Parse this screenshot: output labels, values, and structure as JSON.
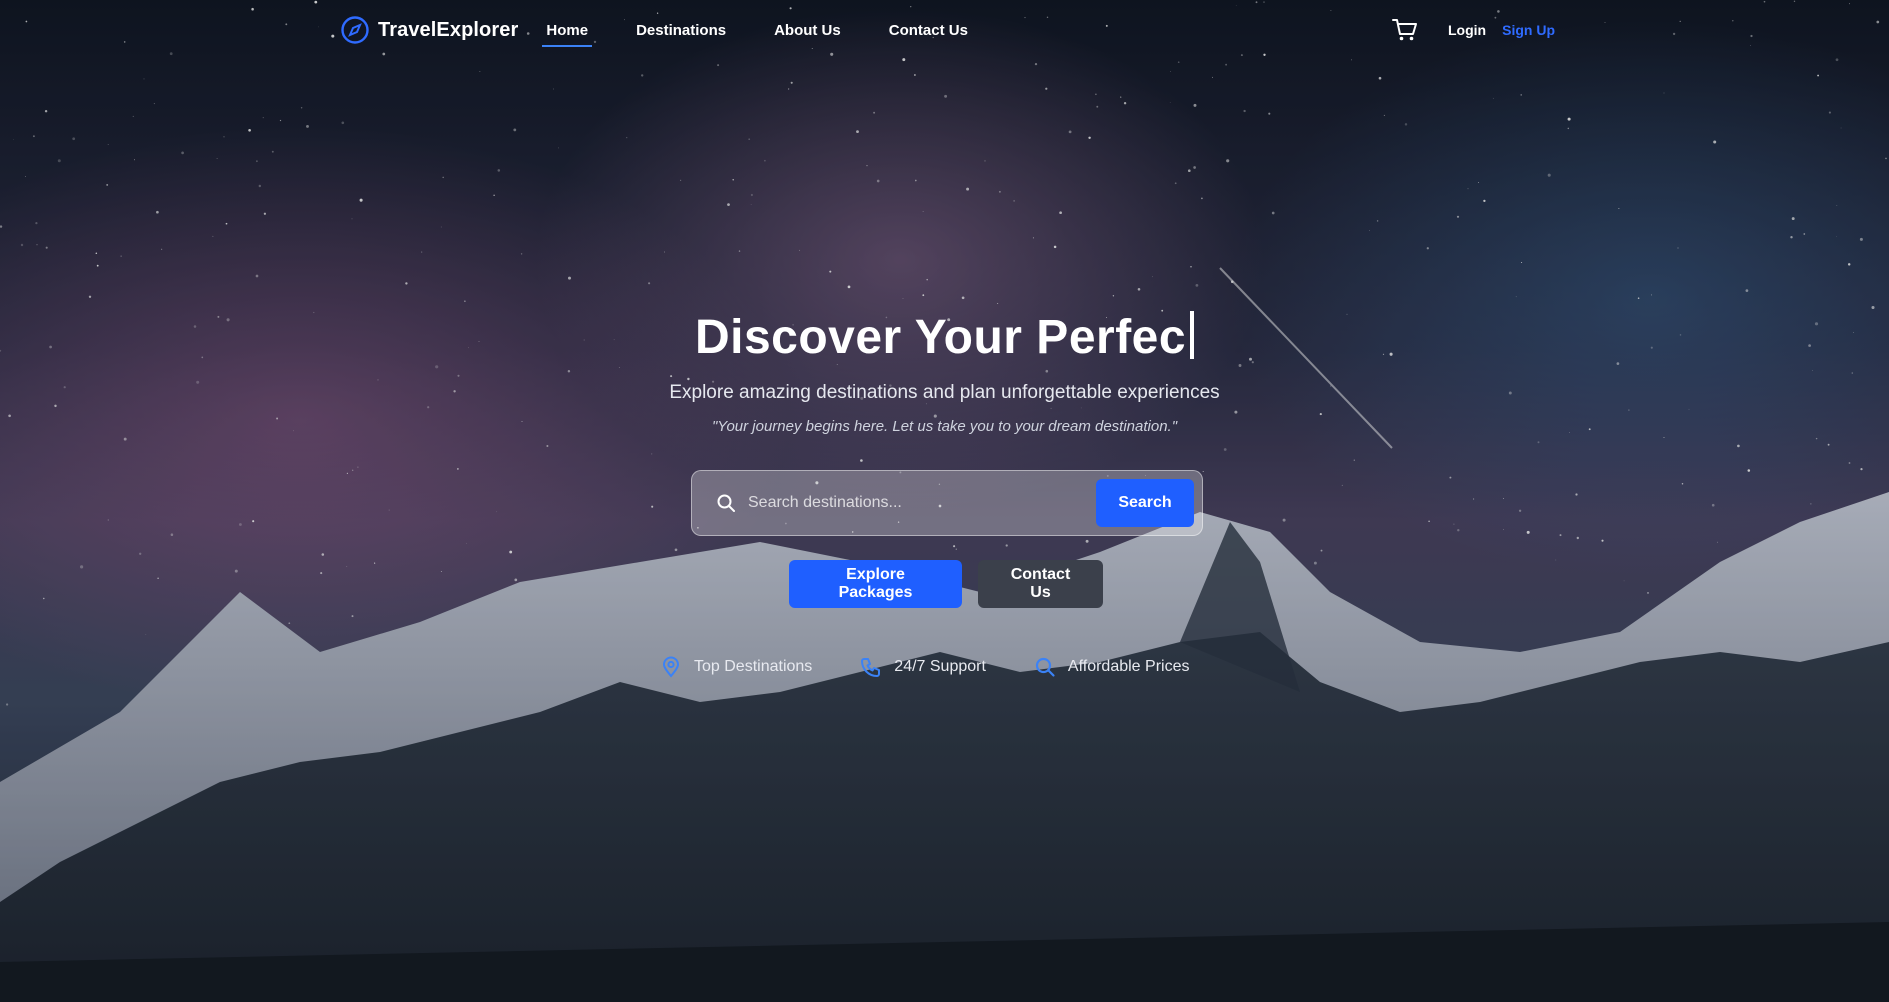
{
  "brand": {
    "name": "TravelExplorer",
    "logo_icon": "compass-icon",
    "accent": "#2f6bff"
  },
  "nav": {
    "items": [
      {
        "label": "Home",
        "active": true
      },
      {
        "label": "Destinations",
        "active": false
      },
      {
        "label": "About Us",
        "active": false
      },
      {
        "label": "Contact Us",
        "active": false
      }
    ],
    "cart_icon": "cart-icon",
    "login_label": "Login",
    "signup_label": "Sign Up"
  },
  "hero": {
    "headline": "Discover Your Perfec",
    "subtitle": "Explore amazing destinations and plan unforgettable experiences",
    "quote": "\"Your journey begins here. Let us take you to your dream destination.\"",
    "search": {
      "placeholder": "Search destinations...",
      "value": "",
      "button_label": "Search"
    },
    "buttons": {
      "primary": "Explore Packages",
      "secondary": "Contact Us"
    },
    "features": [
      {
        "label": "Top Destinations",
        "icon": "map-pin-icon"
      },
      {
        "label": "24/7 Support",
        "icon": "phone-icon"
      },
      {
        "label": "Affordable Prices",
        "icon": "search-icon"
      }
    ]
  }
}
